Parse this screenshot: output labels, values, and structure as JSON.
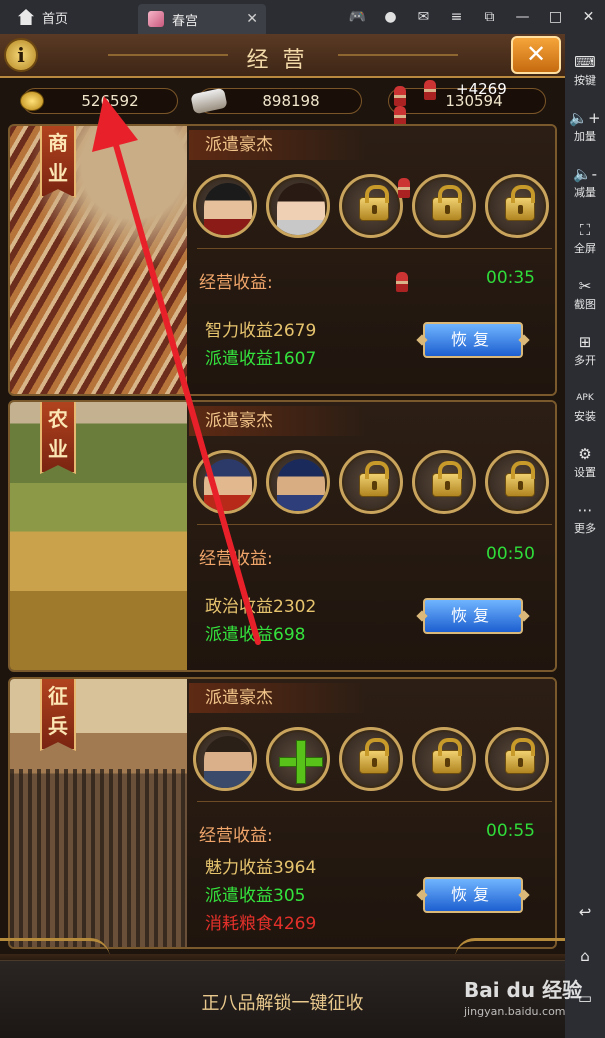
{
  "window": {
    "tab_home_label": "首页",
    "tab_game_label": "春宫",
    "tab_close": "✕",
    "controls": [
      "🎮",
      "●",
      "✉",
      "≡",
      "⧉",
      "—",
      "□",
      "✕"
    ]
  },
  "sidebar": {
    "items": [
      {
        "icon": "keyboard-icon",
        "glyph": "⌨",
        "label": "按键"
      },
      {
        "icon": "volume-up-icon",
        "glyph": "🔈+",
        "label": "加量"
      },
      {
        "icon": "volume-down-icon",
        "glyph": "🔈-",
        "label": "减量"
      },
      {
        "icon": "fullscreen-icon",
        "glyph": "⛶",
        "label": "全屏"
      },
      {
        "icon": "scissors-icon",
        "glyph": "✂",
        "label": "截图"
      },
      {
        "icon": "multi-open-icon",
        "glyph": "⊞",
        "label": "多开"
      },
      {
        "icon": "apk-install-icon",
        "glyph": "APK",
        "label": "安装"
      },
      {
        "icon": "settings-icon",
        "glyph": "⚙",
        "label": "设置"
      },
      {
        "icon": "more-icon",
        "glyph": "⋯",
        "label": "更多"
      }
    ],
    "bottom": [
      {
        "icon": "back-icon",
        "glyph": "↩"
      },
      {
        "icon": "home-icon",
        "glyph": "⌂"
      },
      {
        "icon": "recent-apps-icon",
        "glyph": "▭"
      }
    ]
  },
  "game": {
    "info_label": "i",
    "title": "经营",
    "close_label": "✕",
    "resources": {
      "gold": "526592",
      "silver": "898198",
      "soldiers": "130594",
      "soldiers_delta": "+4269"
    },
    "cards": [
      {
        "banner": "商业",
        "dispatch_label": "派遣豪杰",
        "income_label": "经营收益:",
        "timer": "00:35",
        "stat1": "智力收益2679",
        "stat2": "派遣收益1607",
        "stat3": "",
        "button": "恢复"
      },
      {
        "banner": "农业",
        "dispatch_label": "派遣豪杰",
        "income_label": "经营收益:",
        "timer": "00:50",
        "stat1": "政治收益2302",
        "stat2": "派遣收益698",
        "stat3": "",
        "button": "恢复"
      },
      {
        "banner": "征兵",
        "dispatch_label": "派遣豪杰",
        "income_label": "经营收益:",
        "timer": "00:55",
        "stat1": "魅力收益3964",
        "stat2": "派遣收益305",
        "stat3": "消耗粮食4269",
        "button": "恢复"
      }
    ],
    "unlock_text": "正八品解锁一键征收"
  },
  "watermark": {
    "brand": "Bai du 经验",
    "url": "jingyan.baidu.com"
  },
  "colors": {
    "accent_gold": "#c9a45d",
    "timer_green": "#2fdc3a",
    "button_blue": "#1d5fd0",
    "annotation_red": "#e8202a"
  }
}
